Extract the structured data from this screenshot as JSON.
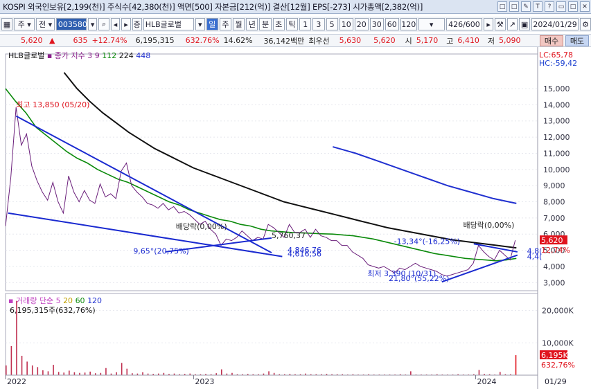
{
  "titlebar": {
    "text": "KOSPI 외국인보유[2,199(천)] 주식수[42,380(천)] 액면[500] 자본금[212(억)] 결산[12월] EPS[-273] 시가총액[2,382(억)]",
    "buttons": [
      "□",
      "□",
      "✎",
      "T",
      "?",
      "▭",
      "□",
      "✕"
    ]
  },
  "toolbar": {
    "mode": "주",
    "prev_label": "전",
    "stock_code": "003580",
    "stock_name": "HLB글로벌",
    "period_buttons": [
      "일",
      "주",
      "월",
      "년",
      "분",
      "초",
      "틱"
    ],
    "number_buttons": [
      "1",
      "3",
      "5",
      "10",
      "20",
      "30",
      "60",
      "120"
    ],
    "count": "426/600",
    "date": "2024/01/29"
  },
  "info": {
    "price": "5,620",
    "change": "635",
    "change_pct": "+12.74%",
    "volume": "6,195,315",
    "volume_pct": "632.76%",
    "turnover": "14.62%",
    "amount": "36,142백만",
    "best_ask_label": "최우선",
    "best_ask": "5,630",
    "best_bid": "5,620",
    "open_label": "시",
    "open": "5,170",
    "high_label": "고",
    "high": "6,410",
    "low_label": "저",
    "low": "5,090",
    "buy_label": "매수",
    "sell_label": "매도"
  },
  "chart_data": {
    "type": "line",
    "stock_label": "HLB글로벌",
    "ma_label": "종가 지수",
    "ma_periods": [
      "3",
      "9",
      "112",
      "224",
      "448"
    ],
    "ma_colors": [
      "#8a1e8a",
      "#8a1e8a",
      "#0b8a0b",
      "#111111",
      "#2030d0"
    ],
    "price_axis_ticks": [
      3000,
      4000,
      5000,
      6000,
      7000,
      8000,
      9000,
      10000,
      11000,
      12000,
      13000,
      14000,
      15000
    ],
    "price_axis_labels": [
      "3,000",
      "4,000",
      "5,000",
      "6,000",
      "7,000",
      "8,000",
      "9,000",
      "10,000",
      "11,000",
      "12,000",
      "13,000",
      "14,000",
      "15,000"
    ],
    "ylim": [
      2500,
      16200
    ],
    "lc_label": "LC:65,78",
    "hc_label": "HC:-59,42",
    "current_price_label": "5,620",
    "current_pct_label": "12,74%",
    "current_price": 5620,
    "x_axis_labels": [
      "2022",
      "2023",
      "2024",
      "01/29"
    ],
    "x_axis_positions": [
      0.0,
      0.38,
      0.95,
      1.0
    ],
    "close": [
      6500,
      9500,
      13850,
      11500,
      12200,
      10200,
      9300,
      8600,
      8100,
      9200,
      8000,
      7300,
      9600,
      8600,
      8000,
      8700,
      8100,
      7900,
      9100,
      8300,
      8500,
      8200,
      9900,
      10400,
      9000,
      8600,
      8300,
      7900,
      7800,
      7600,
      7900,
      7500,
      7700,
      7300,
      7400,
      7200,
      6900,
      6600,
      6800,
      6300,
      6000,
      5300,
      5700,
      5600,
      5800,
      6200,
      5900,
      5600,
      5800,
      5700,
      6600,
      6400,
      6100,
      5800,
      6600,
      6100,
      6100,
      6300,
      5800,
      6300,
      5900,
      5800,
      5600,
      5600,
      5300,
      5300,
      4900,
      4700,
      4500,
      4100,
      4000,
      3900,
      4000,
      3800,
      3600,
      3900,
      3800,
      4000,
      4200,
      4000,
      3900,
      3800,
      3700,
      3500,
      3400,
      3500,
      3600,
      3700,
      3800,
      4200,
      5300,
      4900,
      4600,
      4400,
      5000,
      4700,
      4400,
      5620
    ],
    "ma112": [
      15000,
      14200,
      13500,
      12600,
      12100,
      11600,
      11100,
      10700,
      10400,
      10000,
      9700,
      9400,
      9200,
      8900,
      8600,
      8300,
      8000,
      7800,
      7500,
      7300,
      7100,
      6900,
      6800,
      6600,
      6500,
      6300,
      6200,
      6150,
      6100,
      6080,
      6050,
      6020,
      6000,
      5950,
      5900,
      5800,
      5700,
      5550,
      5400,
      5250,
      5100,
      4950,
      4800,
      4700,
      4600,
      4500,
      4450,
      4400,
      4350,
      4400,
      4500
    ],
    "ma224": [
      16000,
      15000,
      14200,
      13500,
      12900,
      12300,
      11800,
      11300,
      10900,
      10500,
      10100,
      9800,
      9500,
      9200,
      8900,
      8600,
      8300,
      8000,
      7800,
      7600,
      7400,
      7200,
      7000,
      6800,
      6600,
      6400,
      6250,
      6100,
      5950,
      5800,
      5650,
      5550,
      5450,
      5350,
      5250,
      5150
    ],
    "ma448": [
      11400,
      11000,
      10500,
      10000,
      9500,
      9000,
      8600,
      8200,
      7900
    ],
    "annotations": [
      {
        "text": "최고 13,850 (05/20)",
        "price": 13850,
        "pos": 0.02
      },
      {
        "text": "배당락(0,00%)",
        "price": 6300,
        "pos": 0.32
      },
      {
        "text": "5,760,37",
        "price": 5760,
        "pos": 0.5
      },
      {
        "text": "9,65°(20,75%)",
        "price": 4800,
        "pos": 0.24
      },
      {
        "text": "4,846,76",
        "price": 4846,
        "pos": 0.53
      },
      {
        "text": "4,616,56",
        "price": 4616,
        "pos": 0.53
      },
      {
        "text": "-13,34°(-16,25%)",
        "price": 5400,
        "pos": 0.73
      },
      {
        "text": "배당락(0,00%)",
        "price": 6400,
        "pos": 0.86
      },
      {
        "text": "최저 3,390 (10/31)",
        "price": 3390,
        "pos": 0.68
      },
      {
        "text": "21,80°(55,22%)",
        "price": 3100,
        "pos": 0.72
      },
      {
        "text": "4,8(",
        "price": 4800,
        "pos": 0.98
      },
      {
        "text": "4,4(",
        "price": 4450,
        "pos": 0.98
      }
    ],
    "volume": {
      "label": "거래량",
      "ma_label": "단순",
      "ma_periods": [
        "5",
        "20",
        "60",
        "120"
      ],
      "ma_colors": [
        "#c040c0",
        "#c0a000",
        "#0b8a0b",
        "#2030d0"
      ],
      "value_label": "6,195,315주(632,76%)",
      "axis_ticks": [
        10000,
        20000
      ],
      "axis_labels": [
        "10,000K",
        "20,000K"
      ],
      "ylim": [
        0,
        24000
      ],
      "current_label": "6,195K",
      "current_pct_label": "632,76%",
      "current": 6195,
      "bars": [
        3000,
        9000,
        23000,
        6000,
        4200,
        3000,
        2500,
        1500,
        1200,
        3200,
        1000,
        800,
        1400,
        900,
        700,
        800,
        1100,
        600,
        700,
        2200,
        500,
        900,
        3800,
        2000,
        600,
        500,
        900,
        500,
        400,
        500,
        700,
        400,
        500,
        300,
        400,
        500,
        300,
        300,
        400,
        300,
        600,
        1800,
        500,
        700,
        300,
        300,
        400,
        300,
        300,
        500,
        1200,
        700,
        300,
        300,
        400,
        300,
        300,
        500,
        300,
        300,
        300,
        400,
        300,
        300,
        300,
        200,
        300,
        200,
        200,
        300,
        200,
        200,
        200,
        200,
        200,
        300,
        200,
        1200,
        200,
        200,
        200,
        200,
        300,
        200,
        200,
        200,
        300,
        200,
        200,
        300,
        1600,
        400,
        300,
        200,
        1000,
        300,
        300,
        6195
      ]
    }
  }
}
